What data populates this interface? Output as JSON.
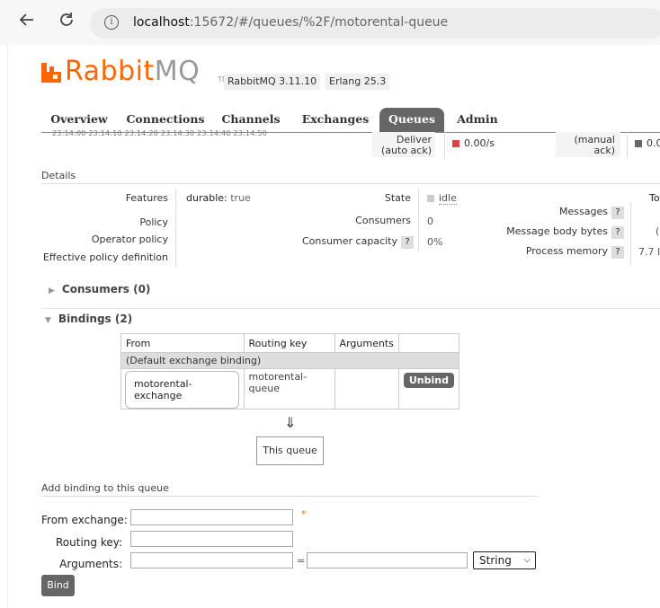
{
  "browser": {
    "url_host": "localhost",
    "url_rest": ":15672/#/queues/%2F/motorental-queue",
    "back_icon": "arrow-left-icon",
    "reload_icon": "reload-icon",
    "info_icon": "info-icon"
  },
  "header": {
    "logo_main": "Rabbit",
    "logo_mq": "MQ",
    "logo_tm": "TM",
    "version": "RabbitMQ 3.11.10",
    "erlang": "Erlang 25.3"
  },
  "tabs": [
    {
      "label": "Overview"
    },
    {
      "label": "Connections"
    },
    {
      "label": "Channels"
    },
    {
      "label": "Exchanges"
    },
    {
      "label": "Queues"
    },
    {
      "label": "Admin"
    }
  ],
  "chart": {
    "axis": "23:14:00   23:14:10   23:14:20   23:14:30   23:14:40   23:14:50",
    "deliver_label_1": "Deliver",
    "deliver_label_2": "(auto ack)",
    "deliver_value": "0.00/s",
    "deliver_color": "#dd4444",
    "manual_label_1": "(manual",
    "manual_label_2": "ack)",
    "manual_value": "0.0",
    "manual_color": "#666666"
  },
  "details": {
    "heading": "Details",
    "features_label": "Features",
    "features_key": "durable:",
    "features_val": "true",
    "policy_label": "Policy",
    "operator_policy_label": "Operator policy",
    "effective_policy_label": "Effective policy definition",
    "state_label": "State",
    "state_val": "idle",
    "consumers_label": "Consumers",
    "consumers_val": "0",
    "capacity_label": "Consumer capacity",
    "capacity_val": "0%",
    "messages_label": "Messages",
    "body_bytes_label": "Message body bytes",
    "process_memory_label": "Process memory",
    "total_partial": "To",
    "paren_partial": "(",
    "memory_partial": "7.7 I",
    "help": "?"
  },
  "consumers": {
    "label": "Consumers (0)"
  },
  "bindings": {
    "label": "Bindings (2)",
    "columns": [
      "From",
      "Routing key",
      "Arguments"
    ],
    "default_row": "(Default exchange binding)",
    "rows": [
      {
        "from": "motorental-exchange",
        "routing_key": "motorental-queue",
        "arguments": "",
        "action": "Unbind"
      }
    ],
    "arrow": "⇓",
    "this_queue": "This queue"
  },
  "add_binding": {
    "heading": "Add binding to this queue",
    "from_exchange_label": "From exchange:",
    "routing_key_label": "Routing key:",
    "arguments_label": "Arguments:",
    "required_mark": "*",
    "equals": "=",
    "type_selected": "String",
    "bind_button": "Bind"
  }
}
